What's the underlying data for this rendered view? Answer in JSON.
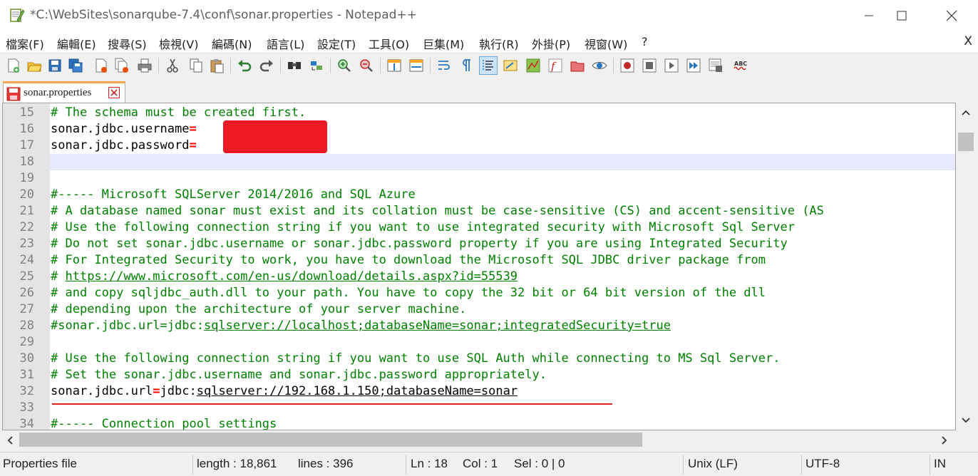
{
  "window": {
    "title": "*C:\\WebSites\\sonarqube-7.4\\conf\\sonar.properties - Notepad++"
  },
  "menu": {
    "items": [
      "檔案(F)",
      "編輯(E)",
      "搜尋(S)",
      "檢視(V)",
      "編碼(N)",
      "語言(L)",
      "設定(T)",
      "工具(O)",
      "巨集(M)",
      "執行(R)",
      "外掛(P)",
      "視窗(W)",
      "?"
    ],
    "close_label": "X"
  },
  "toolbar": {
    "icons": [
      "new-file-icon",
      "open-file-icon",
      "save-icon",
      "save-all-icon",
      "close-icon",
      "close-all-icon",
      "print-icon",
      "cut-icon",
      "copy-icon",
      "paste-icon",
      "undo-icon",
      "redo-icon",
      "find-icon",
      "replace-icon",
      "zoom-in-icon",
      "zoom-out-icon",
      "sync-vertical-icon",
      "sync-horizontal-icon",
      "word-wrap-icon",
      "show-all-chars-icon",
      "indent-guide-icon",
      "udl-icon",
      "doc-map-icon",
      "function-list-icon",
      "folder-workspace-icon",
      "monitor-icon",
      "record-macro-icon",
      "stop-macro-icon",
      "play-macro-icon",
      "run-macro-multiple-icon",
      "save-macro-icon",
      "spell-check-icon"
    ]
  },
  "tab": {
    "label": "sonar.properties"
  },
  "colors": {
    "comment": "#008000",
    "operator": "#ff0000",
    "line_number_bg": "#e4e4e4",
    "current_line": "#e8e8ff",
    "tab_accent": "#f3a34a",
    "redaction": "#ed1c24"
  },
  "editor": {
    "lines": [
      {
        "n": "15",
        "parts": [
          {
            "t": "# The schema must be created first.",
            "c": "comment"
          }
        ]
      },
      {
        "n": "16",
        "parts": [
          {
            "t": "sonar.jdbc.username",
            "c": "key"
          },
          {
            "t": "=",
            "c": "op"
          }
        ]
      },
      {
        "n": "17",
        "parts": [
          {
            "t": "sonar.jdbc.password",
            "c": "key"
          },
          {
            "t": "=",
            "c": "op"
          }
        ]
      },
      {
        "n": "18",
        "current": true,
        "parts": []
      },
      {
        "n": "19",
        "parts": []
      },
      {
        "n": "20",
        "parts": [
          {
            "t": "#----- Microsoft SQLServer 2014/2016 and SQL Azure",
            "c": "comment"
          }
        ]
      },
      {
        "n": "21",
        "parts": [
          {
            "t": "# A database named sonar must exist and its collation must be case-sensitive (CS) and accent-sensitive (AS",
            "c": "comment"
          }
        ]
      },
      {
        "n": "22",
        "parts": [
          {
            "t": "# Use the following connection string if you want to use integrated security with Microsoft Sql Server",
            "c": "comment"
          }
        ]
      },
      {
        "n": "23",
        "parts": [
          {
            "t": "# Do not set sonar.jdbc.username or sonar.jdbc.password property if you are using Integrated Security",
            "c": "comment"
          }
        ]
      },
      {
        "n": "24",
        "parts": [
          {
            "t": "# For Integrated Security to work, you have to download the Microsoft SQL JDBC driver package from",
            "c": "comment"
          }
        ]
      },
      {
        "n": "25",
        "parts": [
          {
            "t": "# ",
            "c": "comment"
          },
          {
            "t": "https://www.microsoft.com/en-us/download/details.aspx?id=55539",
            "c": "comment url"
          }
        ]
      },
      {
        "n": "26",
        "parts": [
          {
            "t": "# and copy sqljdbc_auth.dll to your path. You have to copy the 32 bit or 64 bit version of the dll",
            "c": "comment"
          }
        ]
      },
      {
        "n": "27",
        "parts": [
          {
            "t": "# depending upon the architecture of your server machine.",
            "c": "comment"
          }
        ]
      },
      {
        "n": "28",
        "parts": [
          {
            "t": "#sonar.jdbc.url=jdbc:",
            "c": "comment"
          },
          {
            "t": "sqlserver://localhost;databaseName=sonar;integratedSecurity=true",
            "c": "comment url"
          }
        ]
      },
      {
        "n": "29",
        "parts": []
      },
      {
        "n": "30",
        "parts": [
          {
            "t": "# Use the following connection string if you want to use SQL Auth while connecting to MS Sql Server.",
            "c": "comment"
          }
        ]
      },
      {
        "n": "31",
        "parts": [
          {
            "t": "# Set the sonar.jdbc.username and sonar.jdbc.password appropriately.",
            "c": "comment"
          }
        ]
      },
      {
        "n": "32",
        "parts": [
          {
            "t": "sonar.jdbc.url",
            "c": "key"
          },
          {
            "t": "=",
            "c": "op"
          },
          {
            "t": "jdbc:",
            "c": "key"
          },
          {
            "t": "sqlserver://192.168.1.150;databaseName=sonar",
            "c": "key url"
          }
        ]
      },
      {
        "n": "33",
        "parts": []
      },
      {
        "n": "34",
        "parts": [
          {
            "t": "#----- Connection pool settings",
            "c": "comment"
          }
        ]
      }
    ]
  },
  "status": {
    "file_type": "Properties file",
    "length": "length : 18,861",
    "lines": "lines : 396",
    "ln": "Ln : 18",
    "col": "Col : 1",
    "sel": "Sel : 0 | 0",
    "eol": "Unix (LF)",
    "encoding": "UTF-8",
    "mode": "IN"
  }
}
